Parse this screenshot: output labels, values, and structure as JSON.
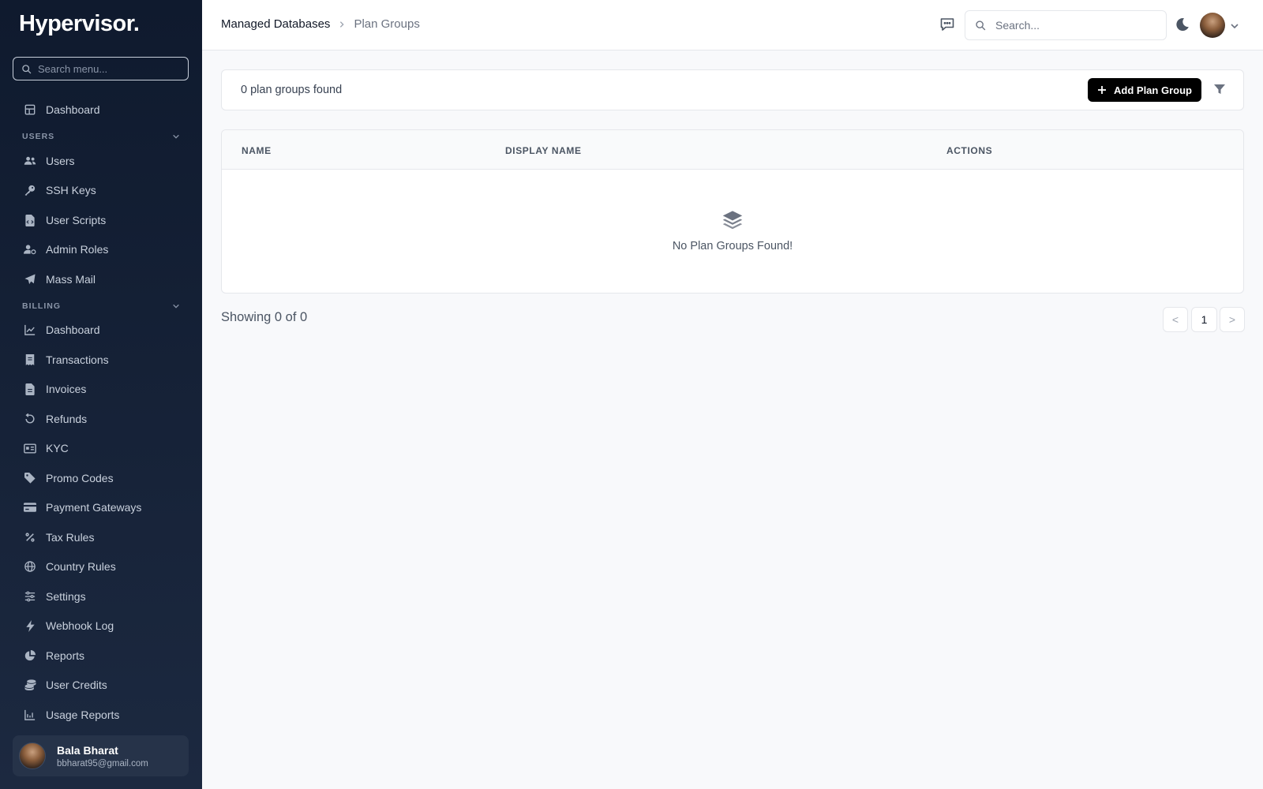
{
  "brand": "Hypervisor.",
  "sidebar": {
    "search_placeholder": "Search menu...",
    "dashboard": "Dashboard",
    "sections": {
      "users": "USERS",
      "billing": "BILLING"
    },
    "users_items": [
      "Users",
      "SSH Keys",
      "User Scripts",
      "Admin Roles",
      "Mass Mail"
    ],
    "billing_items": [
      "Dashboard",
      "Transactions",
      "Invoices",
      "Refunds",
      "KYC",
      "Promo Codes",
      "Payment Gateways",
      "Tax Rules",
      "Country Rules",
      "Settings",
      "Webhook Log",
      "Reports",
      "User Credits",
      "Usage Reports"
    ],
    "user": {
      "name": "Bala Bharat",
      "email": "bbharat95@gmail.com"
    }
  },
  "topbar": {
    "breadcrumb": [
      "Managed Databases",
      "Plan Groups"
    ],
    "search_placeholder": "Search..."
  },
  "toolbar": {
    "found_text": "0 plan groups found",
    "add_label": "Add Plan Group"
  },
  "table": {
    "columns": [
      "NAME",
      "DISPLAY NAME",
      "ACTIONS"
    ],
    "empty_text": "No Plan Groups Found!"
  },
  "pagination": {
    "showing": "Showing 0 of 0",
    "prev": "<",
    "current": "1",
    "next": ">"
  },
  "colors": {
    "sidebar_bg": "#0f1a2e",
    "primary_button": "#000000",
    "page_bg": "#f8f9fb"
  }
}
